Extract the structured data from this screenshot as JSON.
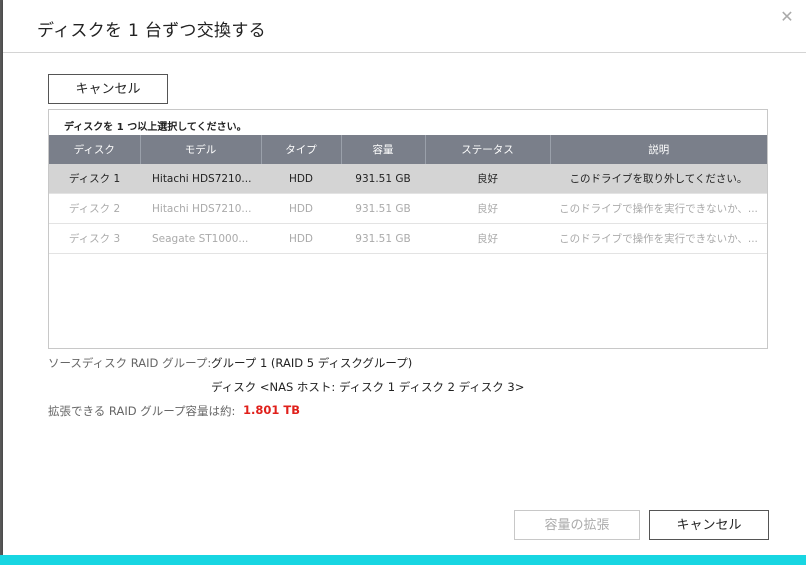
{
  "dialog": {
    "title": "ディスクを 1 台ずつ交換する",
    "close_symbol": "✕"
  },
  "buttons": {
    "top_cancel": "キャンセル",
    "expand": "容量の拡張",
    "bottom_cancel": "キャンセル"
  },
  "panel": {
    "hint": "ディスクを 1 つ以上選択してください。"
  },
  "table": {
    "headers": [
      "ディスク",
      "モデル",
      "タイプ",
      "容量",
      "ステータス",
      "説明"
    ],
    "rows": [
      [
        "ディスク 1",
        "Hitachi HDS7210...",
        "HDD",
        "931.51 GB",
        "良好",
        "このドライブを取り外してください。"
      ],
      [
        "ディスク 2",
        "Hitachi HDS7210...",
        "HDD",
        "931.51 GB",
        "良好",
        "このドライブで操作を実行できないか、..."
      ],
      [
        "ディスク 3",
        "Seagate ST1000...",
        "HDD",
        "931.51 GB",
        "良好",
        "このドライブで操作を実行できないか、..."
      ]
    ]
  },
  "info": {
    "source_label": "ソースディスク RAID グループ:",
    "source_value": "グループ 1 (RAID 5 ディスクグループ)",
    "disks_value": "ディスク <NAS ホスト: ディスク 1 ディスク 2 ディスク 3>",
    "capacity_label": "拡張できる RAID グループ容量は約:",
    "capacity_value": "1.801 TB"
  },
  "colors": {
    "accent": "#18d6e2",
    "header_bg": "#7a7f8a",
    "selected_row": "#d4d4d4",
    "capacity_red": "#e0201b"
  }
}
